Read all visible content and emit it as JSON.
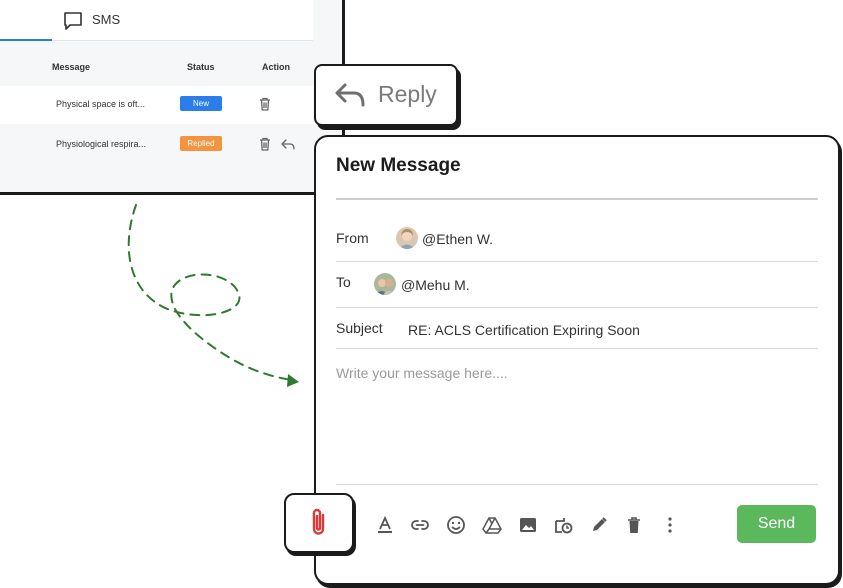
{
  "sms_panel": {
    "tab_label": "SMS",
    "columns": [
      "Message",
      "Status",
      "Action"
    ],
    "rows": [
      {
        "message": "Physical space is oft...",
        "status": "New",
        "status_color": "#2b7de9"
      },
      {
        "message": "Physiological respira...",
        "status": "Replied",
        "status_color": "#f29440"
      }
    ]
  },
  "reply_callout": {
    "label": "Reply",
    "icon": "reply-arrow-icon"
  },
  "compose": {
    "title": "New Message",
    "from_label": "From",
    "from_value": "@Ethen W.",
    "to_label": "To",
    "to_value": "@Mehu M.",
    "subject_label": "Subject",
    "subject_value": "RE: ACLS Certification Expiring Soon",
    "message_placeholder": "Write your message here....",
    "toolbar_icons": [
      "font-color-icon",
      "link-icon",
      "emoji-icon",
      "drive-icon",
      "image-icon",
      "schedule-icon",
      "pen-icon",
      "delete-icon",
      "more-icon"
    ],
    "send_label": "Send",
    "send_color": "#5cb85c"
  },
  "attach_callout": {
    "icon": "paperclip-icon",
    "color": "#d93a3a"
  }
}
